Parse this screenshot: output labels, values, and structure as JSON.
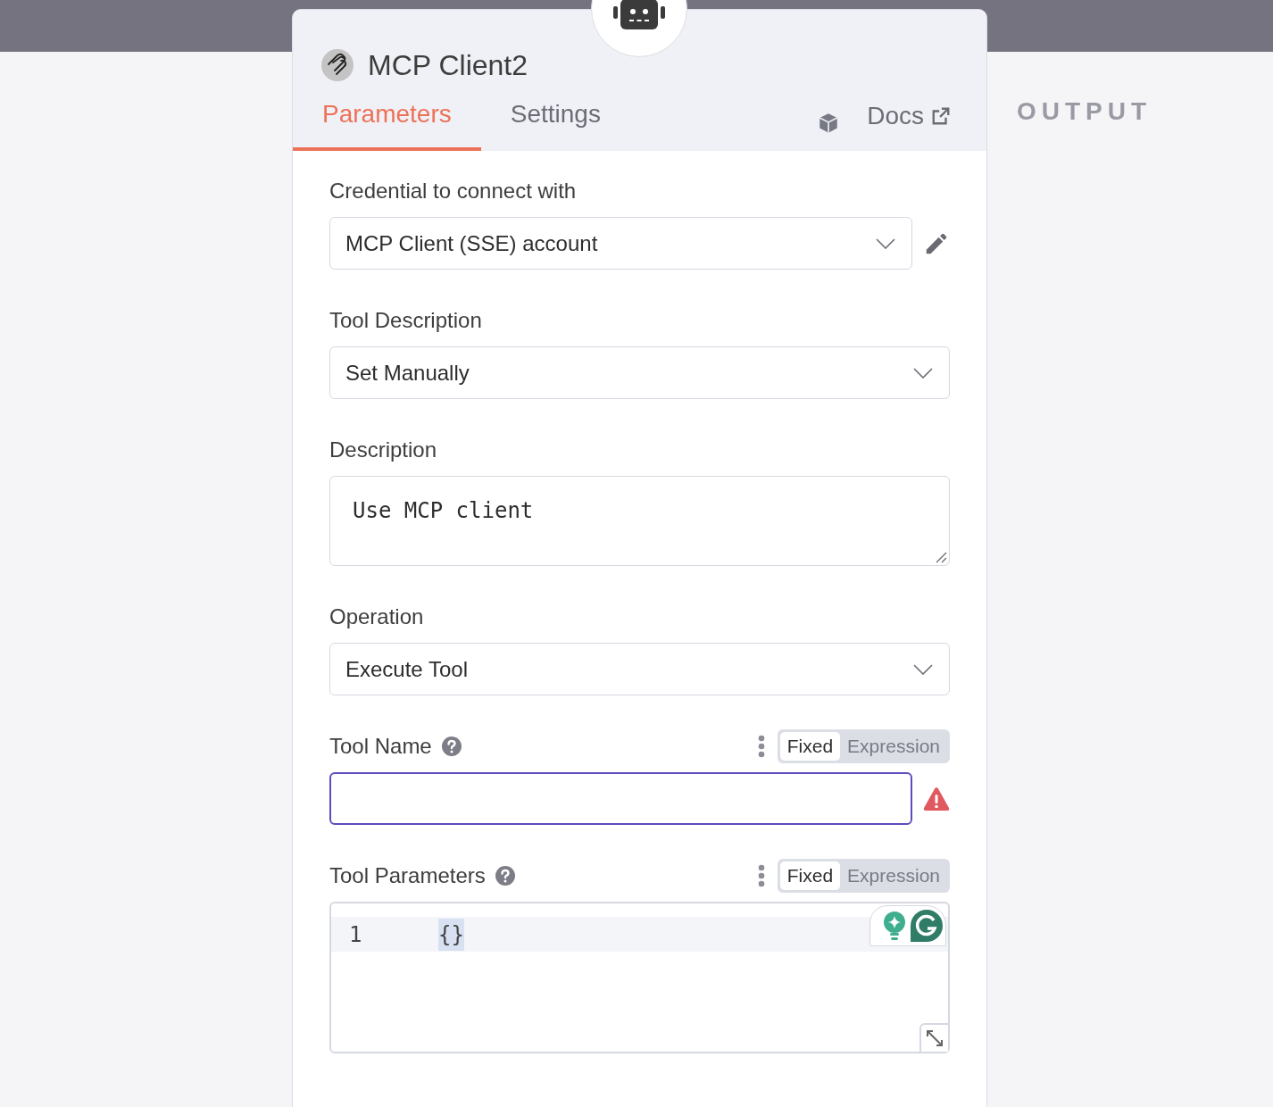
{
  "node": {
    "title": "MCP Client2"
  },
  "tabs": [
    {
      "label": "Parameters",
      "selected": true
    },
    {
      "label": "Settings",
      "selected": false
    }
  ],
  "docs_link": "Docs",
  "fields": [
    {
      "kind": "select",
      "label": "Credential to connect with",
      "value": "MCP Client (SSE) account",
      "editable": true
    },
    {
      "kind": "select",
      "label": "Tool Description",
      "value": "Set Manually"
    },
    {
      "kind": "textarea",
      "label": "Description",
      "value": "Use MCP client"
    },
    {
      "kind": "select",
      "label": "Operation",
      "value": "Execute Tool"
    },
    {
      "kind": "text",
      "label": "Tool Name",
      "help": true,
      "focused": true,
      "error": true,
      "modes": [
        {
          "label": "Fixed",
          "selected": true
        },
        {
          "label": "Expression",
          "selected": false
        }
      ]
    },
    {
      "kind": "code",
      "label": "Tool Parameters",
      "help": true,
      "modes": [
        {
          "label": "Fixed",
          "selected": true
        },
        {
          "label": "Expression",
          "selected": false
        }
      ],
      "lines": [
        {
          "number": "1",
          "code": "{}"
        }
      ]
    }
  ],
  "output_label": "OUTPUT"
}
